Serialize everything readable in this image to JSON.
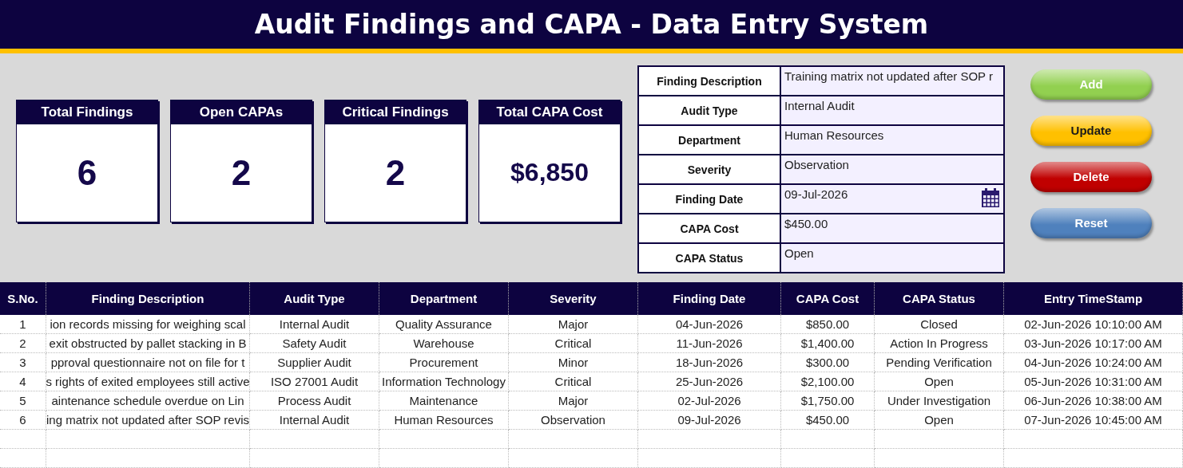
{
  "title": "Audit Findings and CAPA - Data Entry System",
  "kpis": [
    {
      "label": "Total Findings",
      "value": "6"
    },
    {
      "label": "Open CAPAs",
      "value": "2"
    },
    {
      "label": "Critical Findings",
      "value": "2"
    },
    {
      "label": "Total CAPA Cost",
      "value": "$6,850"
    }
  ],
  "form": {
    "fields": [
      {
        "label": "Finding Description",
        "value": "Training matrix not updated after SOP r",
        "kind": "text"
      },
      {
        "label": "Audit Type",
        "value": "Internal Audit",
        "kind": "text"
      },
      {
        "label": "Department",
        "value": "Human Resources",
        "kind": "text"
      },
      {
        "label": "Severity",
        "value": "Observation",
        "kind": "text"
      },
      {
        "label": "Finding Date",
        "value": "09-Jul-2026",
        "kind": "date"
      },
      {
        "label": "CAPA Cost",
        "value": "$450.00",
        "kind": "text"
      },
      {
        "label": "CAPA Status",
        "value": "Open",
        "kind": "text"
      }
    ]
  },
  "buttons": [
    {
      "label": "Add",
      "color": "#92d050"
    },
    {
      "label": "Update",
      "color": "#ffc000"
    },
    {
      "label": "Delete",
      "color": "#c00000"
    },
    {
      "label": "Reset",
      "color": "#4f81bd"
    }
  ],
  "table": {
    "columns": [
      "S.No.",
      "Finding Description",
      "Audit Type",
      "Department",
      "Severity",
      "Finding Date",
      "CAPA Cost",
      "CAPA Status",
      "Entry TimeStamp"
    ],
    "rows": [
      [
        "1",
        "ion records missing for weighing scal",
        "Internal Audit",
        "Quality Assurance",
        "Major",
        "04-Jun-2026",
        "$850.00",
        "Closed",
        "02-Jun-2026 10:10:00 AM"
      ],
      [
        "2",
        "exit obstructed by pallet stacking in B",
        "Safety Audit",
        "Warehouse",
        "Critical",
        "11-Jun-2026",
        "$1,400.00",
        "Action In Progress",
        "03-Jun-2026 10:17:00 AM"
      ],
      [
        "3",
        "pproval questionnaire not on file for t",
        "Supplier Audit",
        "Procurement",
        "Minor",
        "18-Jun-2026",
        "$300.00",
        "Pending Verification",
        "04-Jun-2026 10:24:00 AM"
      ],
      [
        "4",
        "s rights of exited employees still active",
        "ISO 27001 Audit",
        "Information Technology",
        "Critical",
        "25-Jun-2026",
        "$2,100.00",
        "Open",
        "05-Jun-2026 10:31:00 AM"
      ],
      [
        "5",
        "aintenance schedule overdue on Lin",
        "Process Audit",
        "Maintenance",
        "Major",
        "02-Jul-2026",
        "$1,750.00",
        "Under Investigation",
        "06-Jun-2026 10:38:00 AM"
      ],
      [
        "6",
        "ing matrix not updated after SOP revis",
        "Internal Audit",
        "Human Resources",
        "Observation",
        "09-Jul-2026",
        "$450.00",
        "Open",
        "07-Jun-2026 10:45:00 AM"
      ]
    ]
  }
}
